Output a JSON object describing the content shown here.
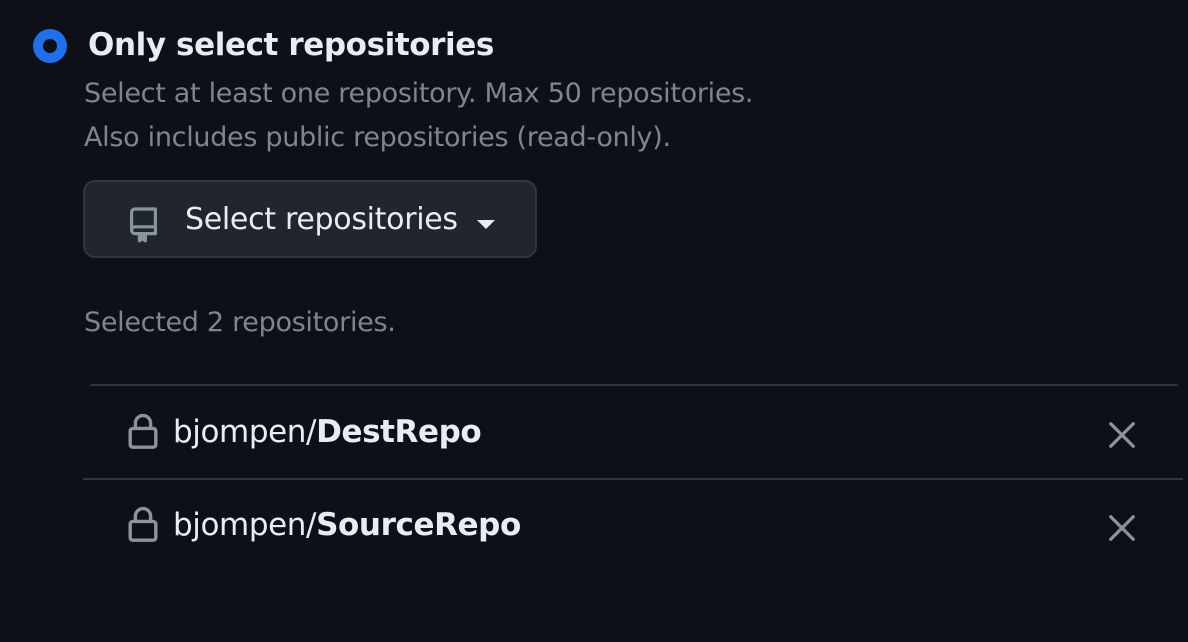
{
  "access_option": {
    "title": "Only select repositories",
    "selected": true,
    "description_line1": "Select at least one repository. Max 50 repositories.",
    "description_line2": "Also includes public repositories (read-only)."
  },
  "select_button": {
    "icon": "repo-icon",
    "label": "Select repositories",
    "caret_icon": "triangle-down-icon"
  },
  "selected_summary": "Selected 2 repositories.",
  "repositories": [
    {
      "owner": "bjompen/",
      "name": "DestRepo",
      "icon": "lock-icon",
      "remove_icon": "x-icon"
    },
    {
      "owner": "bjompen/",
      "name": "SourceRepo",
      "icon": "lock-icon",
      "remove_icon": "x-icon"
    }
  ],
  "colors": {
    "background": "#0d1117",
    "accent": "#1f6feb",
    "text_primary": "#e6edf3",
    "text_muted": "#7d8590",
    "border": "#30363d",
    "button_bg": "#21262d"
  }
}
